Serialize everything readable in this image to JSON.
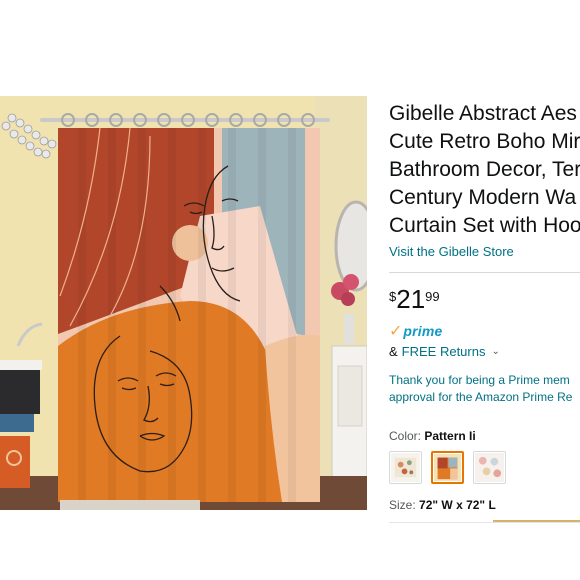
{
  "product": {
    "title_lines": [
      "Gibelle Abstract Aes",
      "Cute Retro Boho Mir",
      "Bathroom Decor, Ter",
      "Century Modern Wa",
      "Curtain Set with Hoo"
    ],
    "store_link": "Visit the Gibelle Store"
  },
  "price": {
    "symbol": "$",
    "whole": "21",
    "fraction": "99"
  },
  "prime": {
    "check": "✓",
    "word": "prime"
  },
  "returns": {
    "ampersand": "&",
    "label": "FREE Returns",
    "chevron": "⌄"
  },
  "prime_message": {
    "line1": "Thank you for being a Prime mem",
    "line2": "approval for the Amazon Prime Re"
  },
  "color": {
    "label": "Color:",
    "value": "Pattern Ii"
  },
  "size": {
    "label": "Size:",
    "value": "72\" W x 72\" L"
  },
  "colors": {
    "link": "#007185",
    "prime_blue": "#1399c5",
    "prime_check": "#f3a847",
    "swatch_selected": "#e77600"
  },
  "icons": {
    "returns_chevron": "chevron-down-icon",
    "prime_check": "check-icon"
  }
}
